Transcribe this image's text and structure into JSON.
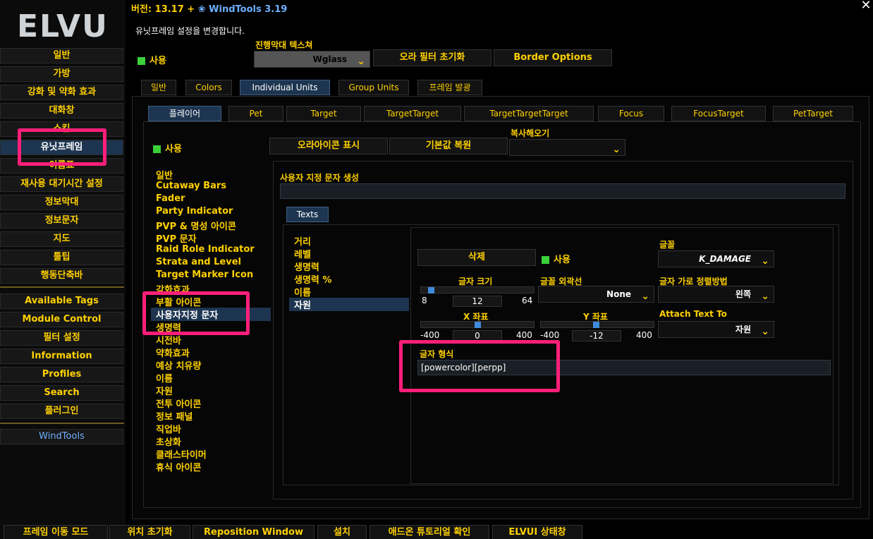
{
  "header": {
    "version_label": "버전: 13.17 +",
    "plugin_name": "WindTools 3.19",
    "description": "유닛프레임 설정을 변경합니다.",
    "close": "✕"
  },
  "sidebar": {
    "logo": "ELVUI",
    "items": [
      {
        "label": "일반"
      },
      {
        "label": "가방"
      },
      {
        "label": "강화 및 약화 효과"
      },
      {
        "label": "대화창"
      },
      {
        "label": "스킨"
      },
      {
        "label": "유닛프레임"
      },
      {
        "label": "이름표"
      },
      {
        "label": "재사용 대기시간 설정"
      },
      {
        "label": "정보막대"
      },
      {
        "label": "정보문자"
      },
      {
        "label": "지도"
      },
      {
        "label": "툴팁"
      },
      {
        "label": "행동단축바"
      },
      {
        "label": "Available Tags"
      },
      {
        "label": "Module Control"
      },
      {
        "label": "필터 설정"
      },
      {
        "label": "Information"
      },
      {
        "label": "Profiles"
      },
      {
        "label": "Search"
      },
      {
        "label": "플러그인"
      },
      {
        "label": "WindTools"
      }
    ]
  },
  "top_controls": {
    "enable_label": "사용",
    "texture_label": "진행막대 텍스쳐",
    "texture_value": "Wglass",
    "reset_aura_filter": "오라 필터 초기화",
    "border_options": "Border Options"
  },
  "main_tabs": [
    "일반",
    "Colors",
    "Individual Units",
    "Group Units",
    "프레임 발광"
  ],
  "unit_tabs": [
    "플레이어",
    "Pet",
    "Target",
    "TargetTarget",
    "TargetTargetTarget",
    "Focus",
    "FocusTarget",
    "PetTarget"
  ],
  "unit_controls": {
    "enable_label": "사용",
    "show_aura_icon": "오라아이콘 표시",
    "restore_defaults": "기본값 복원",
    "copy_from_label": "복사해오기",
    "copy_from_value": ""
  },
  "unit_sections": [
    "일반",
    "Cutaway Bars",
    "Fader",
    "Party Indicator",
    "PVP & 명성 아이콘",
    "PVP 문자",
    "Raid Role Indicator",
    "Strata and Level",
    "Target Marker Icon",
    "강화효과",
    "부활 아이콘",
    "사용자지정 문자",
    "생명력",
    "시전바",
    "약화효과",
    "예상 치유량",
    "이름",
    "자원",
    "전투 아이콘",
    "정보 패널",
    "직업바",
    "초상화",
    "클래스타이머",
    "휴식 아이콘"
  ],
  "custom_text": {
    "create_label": "사용자 지정 문자 생성",
    "create_value": "",
    "texts_tab": "Texts",
    "entries": [
      "거리",
      "레벨",
      "생명력",
      "생명력 %",
      "이름",
      "자원"
    ],
    "delete_button": "삭제",
    "enable_label": "사용",
    "font_label": "글꼴",
    "font_value": "K_DAMAGE",
    "font_size_label": "글자 크기",
    "font_size": {
      "min": "8",
      "value": "12",
      "max": "64",
      "fraction": 0.07
    },
    "outline_label": "글꼴 외곽선",
    "outline_value": "None",
    "justify_label": "글자 가로 정렬방법",
    "justify_value": "왼쪽",
    "x_label": "X 좌표",
    "x": {
      "min": "-400",
      "value": "0",
      "max": "400",
      "fraction": 0.5
    },
    "y_label": "Y 좌표",
    "y": {
      "min": "-400",
      "value": "-12",
      "max": "400",
      "fraction": 0.485
    },
    "attach_label": "Attach Text To",
    "attach_value": "자원",
    "format_label": "글자 형식",
    "format_value": "[powercolor][perpp]"
  },
  "footer": [
    "프레임 이동 모드",
    "위치 초기화",
    "Reposition Window",
    "설치",
    "애드온 튜토리얼 확인",
    "ELVUI 상태창"
  ],
  "colors": {
    "accent": "#ffd100",
    "selected": "#1d3550",
    "highlight": "#ff1f7a",
    "check": "#3ad13a"
  }
}
